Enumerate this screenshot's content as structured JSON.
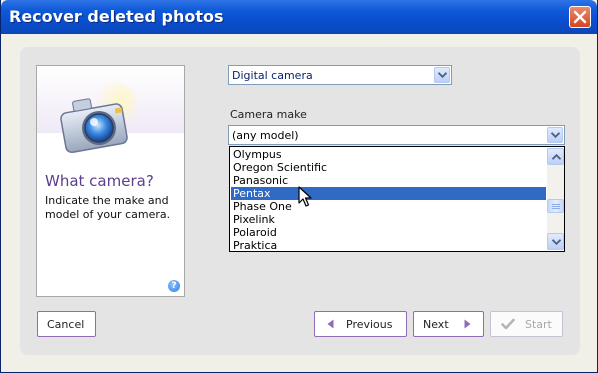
{
  "window": {
    "title": "Recover deleted photos",
    "close_label": "✕"
  },
  "info_card": {
    "title": "What camera?",
    "description": "Indicate the make and model of your camera.",
    "help_icon_label": "?",
    "camera_icon": "camera-icon"
  },
  "device_type": {
    "selected": "Digital camera"
  },
  "camera_make": {
    "label": "Camera make",
    "selected": "(any model)",
    "options": [
      "Olympus",
      "Oregon Scientific",
      "Panasonic",
      "Pentax",
      "Phase One",
      "Pixelink",
      "Polaroid",
      "Praktica"
    ],
    "highlighted": "Pentax"
  },
  "buttons": {
    "cancel": "Cancel",
    "previous": "Previous",
    "next": "Next",
    "start": "Start"
  },
  "colors": {
    "accent": "#8e6cb6",
    "selection": "#316ac5",
    "title_purple": "#5b3f8c"
  }
}
